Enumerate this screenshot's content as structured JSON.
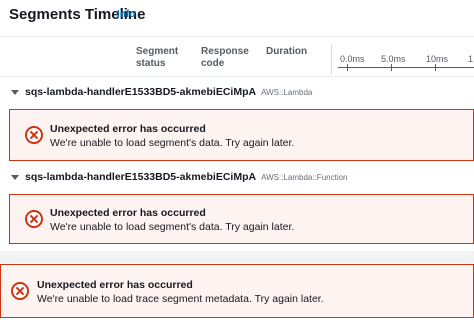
{
  "header": {
    "title": "Segments Timeline",
    "info_link": "Info"
  },
  "columns": {
    "status": "Segment status",
    "response": "Response code",
    "duration": "Duration"
  },
  "axis": {
    "ticks": [
      "0.0ms",
      "5.0ms",
      "10ms",
      "1"
    ]
  },
  "segments": [
    {
      "name": "sqs-lambda-handlerE1533BD5-akmebiECiMpA",
      "type": "AWS::Lambda",
      "error_title": "Unexpected error has occurred",
      "error_message": "We're unable to load segment's data. Try again later."
    },
    {
      "name": "sqs-lambda-handlerE1533BD5-akmebiECiMpA",
      "type": "AWS::Lambda::Function",
      "error_title": "Unexpected error has occurred",
      "error_message": "We're unable to load segment's data. Try again later."
    }
  ],
  "trace_error": {
    "title": "Unexpected error has occurred",
    "message": "We're unable to load trace segment metadata. Try again later."
  },
  "colors": {
    "error": "#d13212",
    "link": "#0073bb",
    "error_bg": "#fdf3f1"
  }
}
